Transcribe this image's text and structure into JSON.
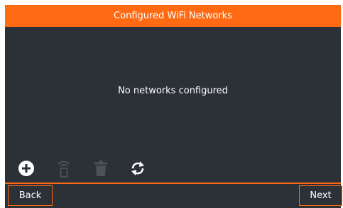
{
  "header": {
    "title": "Configured WiFi Networks"
  },
  "main": {
    "empty_message": "No networks configured"
  },
  "toolbar": {
    "icons": [
      "add-circle-icon",
      "wifi-signal-icon",
      "trash-icon",
      "refresh-icon"
    ],
    "enabled_color": "#ffffff",
    "disabled_color": "#4a5258"
  },
  "footer": {
    "back_label": "Back",
    "next_label": "Next"
  },
  "colors": {
    "accent": "#ff6a13",
    "background": "#2b3137",
    "text": "#ffffff"
  }
}
